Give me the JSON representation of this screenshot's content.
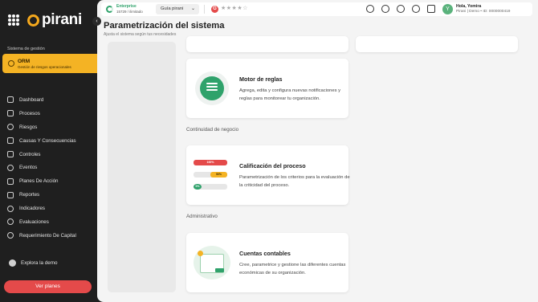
{
  "sidebar": {
    "logo_text": "pirani",
    "section_label": "Sistema de gestión",
    "active_module": {
      "title": "ORM",
      "subtitle": "Gestión de riesgos operacionales"
    },
    "items": [
      {
        "label": "Dashboard",
        "icon": "monitor-icon"
      },
      {
        "label": "Procesos",
        "icon": "list-icon"
      },
      {
        "label": "Riesgos",
        "icon": "alert-icon"
      },
      {
        "label": "Causas Y Consecuencias",
        "icon": "cause-icon"
      },
      {
        "label": "Controles",
        "icon": "sliders-icon"
      },
      {
        "label": "Eventos",
        "icon": "bolt-icon"
      },
      {
        "label": "Planes De Acción",
        "icon": "checklist-icon"
      },
      {
        "label": "Reportes",
        "icon": "report-icon"
      },
      {
        "label": "Indicadores",
        "icon": "indicator-icon"
      },
      {
        "label": "Evaluaciones",
        "icon": "evaluation-icon"
      },
      {
        "label": "Requerimiento De Capital",
        "icon": "capital-icon"
      }
    ],
    "explore_label": "Explora la demo",
    "plans_label": "Ver planes"
  },
  "topbar": {
    "plan_name": "Enterprise",
    "plan_sub": "15729 / ilimitado",
    "guide_label": "Guía pirani",
    "rating_letter": "G",
    "stars": "★★★★☆",
    "user_name": "Hola, Yomira",
    "user_sub": "Pirani | Demo • ID: 0000000419",
    "avatar_letter": "Y"
  },
  "page": {
    "title": "Parametrización del sistema",
    "subtitle": "Ajusta el sistema según tus necesidades"
  },
  "sections": {
    "continuity_label": "Continuidad de negocio",
    "admin_label": "Administrativo"
  },
  "cards": {
    "rules": {
      "title": "Motor de reglas",
      "desc": "Agrega, edita y configura nuevas notificaciones y reglas para monitorear tu organización."
    },
    "process": {
      "title": "Calificación del proceso",
      "desc": "Parametrización de los criterios para la evaluación de la criticidad del proceso.",
      "bars": [
        {
          "label": "100%",
          "color": "#e44a4a",
          "fill": 1.0
        },
        {
          "label": "50%",
          "color": "#f4b324",
          "fill": 0.5
        },
        {
          "label": "0%",
          "color": "#2fa26b",
          "fill": 0.0
        }
      ]
    },
    "accounts": {
      "title": "Cuentas contables",
      "desc": "Cree, parametrice y gestione las diferentes cuentas económicas de su organización."
    }
  }
}
